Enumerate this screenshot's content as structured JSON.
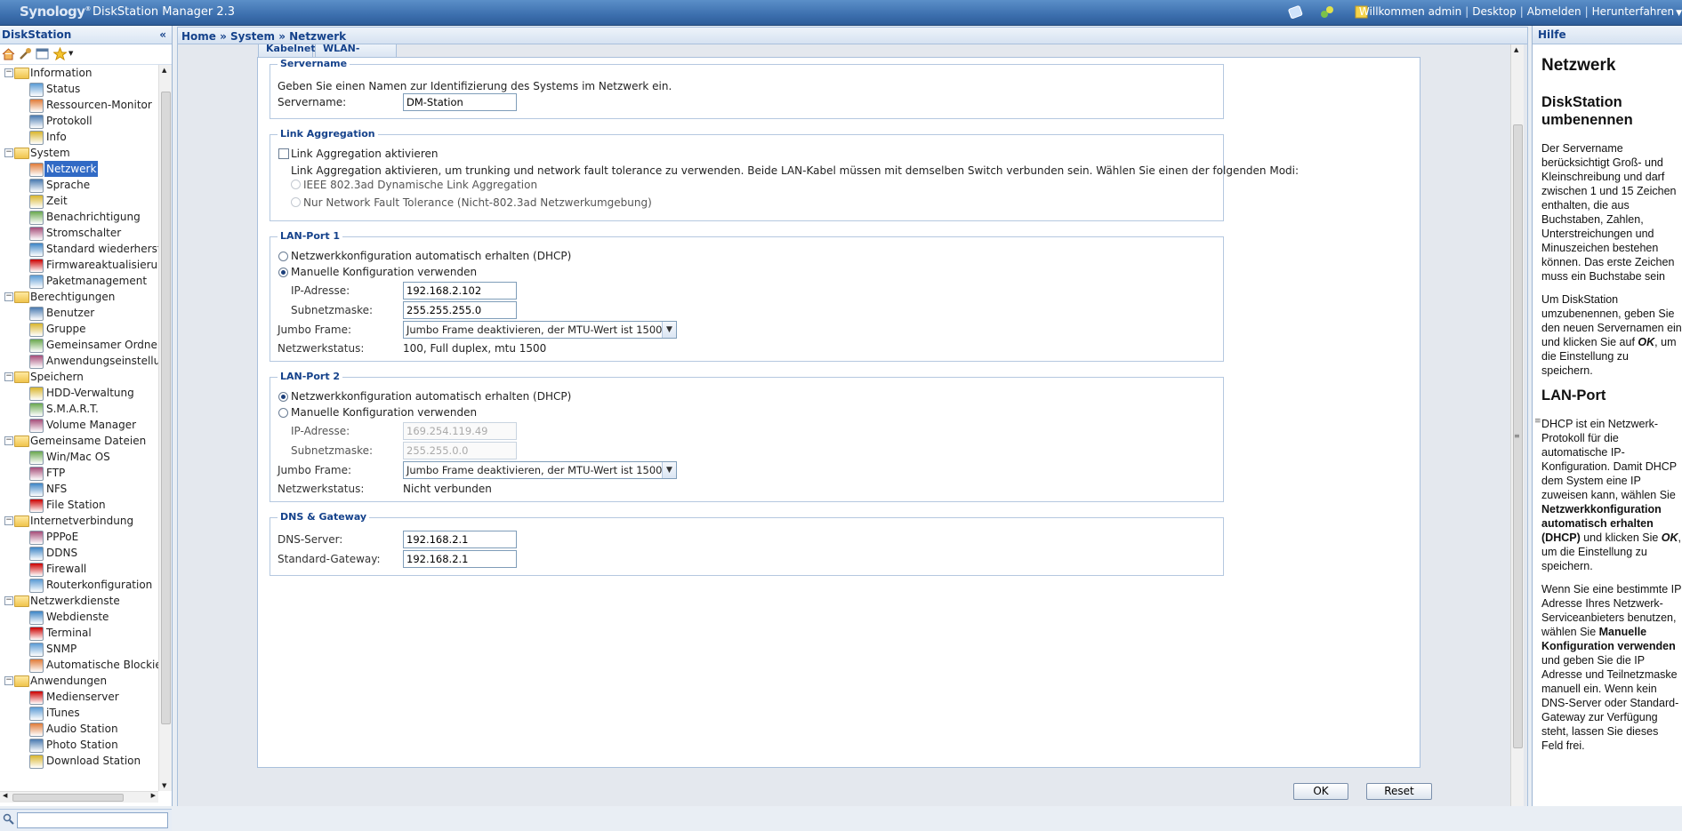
{
  "header": {
    "logo": "Synology",
    "app_title": "DiskStation Manager 2.3",
    "links": [
      "Willkommen admin",
      "Desktop",
      "Abmelden",
      "Herunterfahren"
    ]
  },
  "sidebar": {
    "title": "DiskStation",
    "search_placeholder": "",
    "tree": [
      {
        "label": "Information",
        "items": [
          "Status",
          "Ressourcen-Monitor",
          "Protokoll",
          "Info"
        ]
      },
      {
        "label": "System",
        "items": [
          "Netzwerk",
          "Sprache",
          "Zeit",
          "Benachrichtigung",
          "Stromschalter",
          "Standard wiederherste",
          "Firmwareaktualisierung",
          "Paketmanagement"
        ]
      },
      {
        "label": "Berechtigungen",
        "items": [
          "Benutzer",
          "Gruppe",
          "Gemeinsamer Ordner",
          "Anwendungseinstellun"
        ]
      },
      {
        "label": "Speichern",
        "items": [
          "HDD-Verwaltung",
          "S.M.A.R.T.",
          "Volume Manager"
        ]
      },
      {
        "label": "Gemeinsame Dateien",
        "items": [
          "Win/Mac OS",
          "FTP",
          "NFS",
          "File Station"
        ]
      },
      {
        "label": "Internetverbindung",
        "items": [
          "PPPoE",
          "DDNS",
          "Firewall",
          "Routerkonfiguration"
        ]
      },
      {
        "label": "Netzwerkdienste",
        "items": [
          "Webdienste",
          "Terminal",
          "SNMP",
          "Automatische Blockieru"
        ]
      },
      {
        "label": "Anwendungen",
        "items": [
          "Medienserver",
          "iTunes",
          "Audio Station",
          "Photo Station",
          "Download Station"
        ]
      }
    ],
    "selected": "Netzwerk"
  },
  "breadcrumb": "Home » System » Netzwerk",
  "tabs": [
    "Kabelnetz",
    "WLAN-Netzwerk"
  ],
  "servername": {
    "legend": "Servername",
    "description": "Geben Sie einen Namen zur Identifizierung des Systems im Netzwerk ein.",
    "label": "Servername:",
    "value": "DM-Station"
  },
  "link_aggregation": {
    "legend": "Link Aggregation",
    "checkbox_label": "Link Aggregation aktivieren",
    "description": "Link Aggregation aktivieren, um trunking und network fault tolerance zu verwenden. Beide LAN-Kabel müssen mit demselben Switch verbunden sein. Wählen Sie einen der folgenden Modi:",
    "option1": "IEEE 802.3ad Dynamische Link Aggregation",
    "option2": "Nur Network Fault Tolerance (Nicht-802.3ad Netzwerkumgebung)"
  },
  "lan1": {
    "legend": "LAN-Port 1",
    "dhcp_label": "Netzwerkkonfiguration automatisch erhalten (DHCP)",
    "manual_label": "Manuelle Konfiguration verwenden",
    "ip_label": "IP-Adresse:",
    "ip": "192.168.2.102",
    "mask_label": "Subnetzmaske:",
    "mask": "255.255.255.0",
    "jumbo_label": "Jumbo Frame:",
    "jumbo": "Jumbo Frame deaktivieren, der MTU-Wert ist 1500",
    "status_label": "Netzwerkstatus:",
    "status": "100, Full duplex, mtu 1500"
  },
  "lan2": {
    "legend": "LAN-Port 2",
    "dhcp_label": "Netzwerkkonfiguration automatisch erhalten (DHCP)",
    "manual_label": "Manuelle Konfiguration verwenden",
    "ip_label": "IP-Adresse:",
    "ip": "169.254.119.49",
    "mask_label": "Subnetzmaske:",
    "mask": "255.255.0.0",
    "jumbo_label": "Jumbo Frame:",
    "jumbo": "Jumbo Frame deaktivieren, der MTU-Wert ist 1500",
    "status_label": "Netzwerkstatus:",
    "status": "Nicht verbunden"
  },
  "dns": {
    "legend": "DNS & Gateway",
    "dns_label": "DNS-Server:",
    "dns": "192.168.2.1",
    "gw_label": "Standard-Gateway:",
    "gw": "192.168.2.1"
  },
  "buttons": {
    "ok": "OK",
    "reset": "Reset"
  },
  "help": {
    "title": "Hilfe",
    "h1": "Netzwerk",
    "h2a": "DiskStation umbenennen",
    "p1": "Der Servername berücksichtigt Groß- und Kleinschreibung und darf zwischen 1 und 15 Zeichen enthalten, die aus Buchstaben, Zahlen, Unterstreichungen und Minuszeichen bestehen können. Das erste Zeichen muss ein Buchstabe sein",
    "p2a": "Um DiskStation umzubenennen, geben Sie den neuen Servernamen ein und klicken Sie auf",
    "p2ok": "OK",
    "p2b": ", um die Einstellung zu speichern.",
    "h2b": "LAN-Port",
    "p3a": "DHCP ist ein Netzwerk-Protokoll für die automatische IP-Konfiguration. Damit DHCP dem System eine IP zuweisen kann, wählen Sie",
    "p3bold": "Netzwerkkonfiguration automatisch erhalten (DHCP)",
    "p3b": "und klicken Sie",
    "p3ok": "OK",
    "p3c": ", um die Einstellung zu speichern.",
    "p4a": "Wenn Sie eine bestimmte IP Adresse Ihres Netzwerk-Serviceanbieters benutzen, wählen Sie",
    "p4bold": "Manuelle Konfiguration verwenden",
    "p4b": "und geben Sie die IP Adresse und Teilnetzmaske manuell ein. Wenn kein DNS-Server oder Standard-Gateway zur Verfügung steht, lassen Sie dieses Feld frei."
  },
  "colors": {
    "header": "#3c6fae",
    "accent": "#15428b",
    "selection": "#316ac5"
  }
}
